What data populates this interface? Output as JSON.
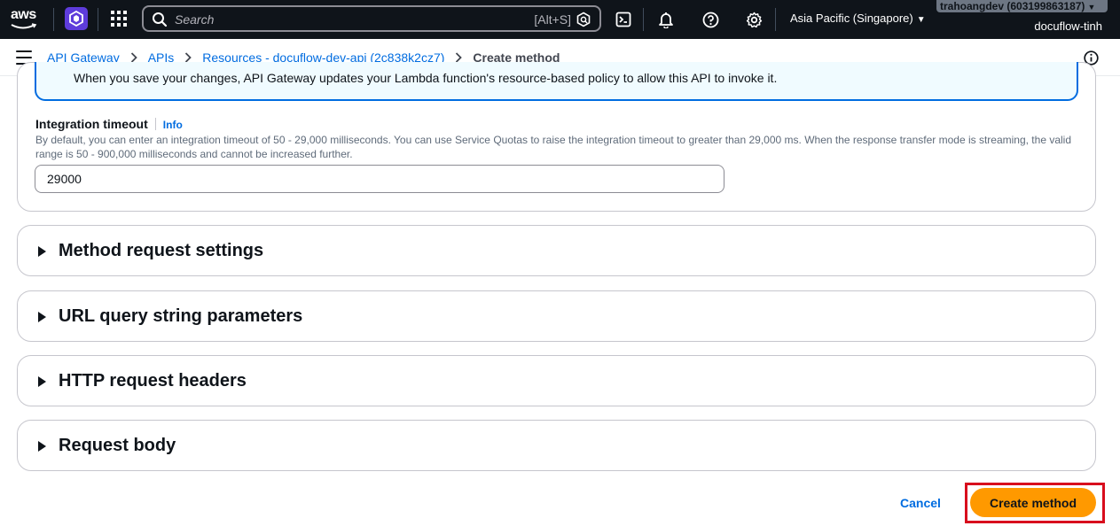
{
  "topnav": {
    "logo_text": "aws",
    "search": {
      "placeholder": "Search",
      "shortcut": "[Alt+S]"
    },
    "region": "Asia Pacific (Singapore)",
    "account_badge": "trahoangdev (603199863187)",
    "account_name": "docuflow-tinh",
    "icons": [
      "service-icon",
      "apps-grid-icon",
      "cloudshell-icon",
      "bell-icon",
      "help-icon",
      "gear-icon"
    ]
  },
  "breadcrumb": {
    "items": [
      "API Gateway",
      "APIs",
      "Resources - docuflow-dev-api (2c838k2cz7)"
    ],
    "current": "Create method"
  },
  "alert": {
    "message": "When you save your changes, API Gateway updates your Lambda function's resource-based policy to allow this API to invoke it."
  },
  "integration_timeout": {
    "label": "Integration timeout",
    "info": "Info",
    "description": "By default, you can enter an integration timeout of 50 - 29,000 milliseconds. You can use Service Quotas to raise the integration timeout to greater than 29,000 ms. When the response transfer mode is streaming, the valid range is 50 - 900,000 milliseconds and cannot be increased further.",
    "value": "29000"
  },
  "sections": [
    {
      "title": "Method request settings"
    },
    {
      "title": "URL query string parameters"
    },
    {
      "title": "HTTP request headers"
    },
    {
      "title": "Request body"
    }
  ],
  "footer": {
    "cancel": "Cancel",
    "submit": "Create method"
  },
  "colors": {
    "nav_bg": "#0f141a",
    "link": "#006ce0",
    "primary_button": "#ff9900",
    "highlight": "#d80d1d",
    "alert_bg": "#f0fbff"
  }
}
